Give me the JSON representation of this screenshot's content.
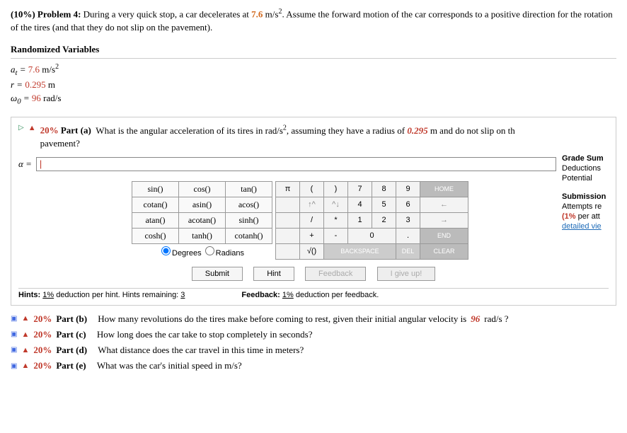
{
  "problem": {
    "pct_label": "(10%) Problem 4:",
    "text_1": "During a very quick stop, a car decelerates at ",
    "decel": "7.6",
    "decel_unit": " m/s",
    "text_2": ". Assume the forward motion of the car corresponds to a positive direction for the rotation of the tires (and that they do not slip on the pavement)."
  },
  "rand_title": "Randomized Variables",
  "vars": {
    "a_lhs": "a",
    "a_sub": "t",
    "a_eq": " = ",
    "a_val": "7.6",
    "a_unit": " m/s",
    "r_lhs": "r = ",
    "r_val": "0.295",
    "r_unit": " m",
    "w_lhs": "ω",
    "w_sub": "0",
    "w_eq": " = ",
    "w_val": "96",
    "w_unit": " rad/s"
  },
  "part_a": {
    "pct": "20%",
    "label": "Part (a)",
    "q1": "What is the angular acceleration of its tires in rad/s",
    "q2": ", assuming they have a radius of ",
    "radius": "0.295",
    "q3": " m and do not slip on th",
    "q4": "pavement?",
    "alpha_lbl": "α =",
    "alpha_val": "|"
  },
  "grade": {
    "hdr": "Grade Sum",
    "ded": "Deductions",
    "pot": "Potential"
  },
  "sub": {
    "hdr": "Submission",
    "att": "Attempts re",
    "ded": "(1% per att",
    "link": "detailed vie"
  },
  "fn": {
    "r1": [
      "sin()",
      "cos()",
      "tan()"
    ],
    "r2": [
      "cotan()",
      "asin()",
      "acos()"
    ],
    "r3": [
      "atan()",
      "acotan()",
      "sinh()"
    ],
    "r4": [
      "cosh()",
      "tanh()",
      "cotanh()"
    ],
    "deg": "Degrees",
    "rad": "Radians"
  },
  "kp": {
    "pi": "π",
    "lp": "(",
    "rp": ")",
    "k7": "7",
    "k8": "8",
    "k9": "9",
    "home": "HOME",
    "up": "↑^",
    "dn": "^↓",
    "k4": "4",
    "k5": "5",
    "k6": "6",
    "left": "←",
    "sl": "/",
    "st": "*",
    "k1": "1",
    "k2": "2",
    "k3": "3",
    "right": "→",
    "pl": "+",
    "mi": "-",
    "k0": "0",
    "dot": ".",
    "end": "END",
    "sq": "√()",
    "bs": "BACKSPACE",
    "del": "DEL",
    "clr": "CLEAR"
  },
  "btns": {
    "submit": "Submit",
    "hint": "Hint",
    "fb": "Feedback",
    "give": "I give up!"
  },
  "foot": {
    "hints_lbl": "Hints:",
    "hints_pct": "1%",
    "hints_txt": " deduction per hint. Hints remaining: ",
    "hints_rem": "3",
    "fb_lbl": "Feedback:",
    "fb_pct": "1%",
    "fb_txt": " deduction per feedback."
  },
  "parts": {
    "b": {
      "pct": "20%",
      "lbl": "Part (b)",
      "t1": "How many revolutions do the tires make before coming to rest, given their initial angular velocity is ",
      "val": "96",
      "t2": " rad/s ?"
    },
    "c": {
      "pct": "20%",
      "lbl": "Part (c)",
      "t": "How long does the car take to stop completely in seconds?"
    },
    "d": {
      "pct": "20%",
      "lbl": "Part (d)",
      "t": "What distance does the car travel in this time in meters?"
    },
    "e": {
      "pct": "20%",
      "lbl": "Part (e)",
      "t": "What was the car's initial speed in m/s?"
    }
  }
}
